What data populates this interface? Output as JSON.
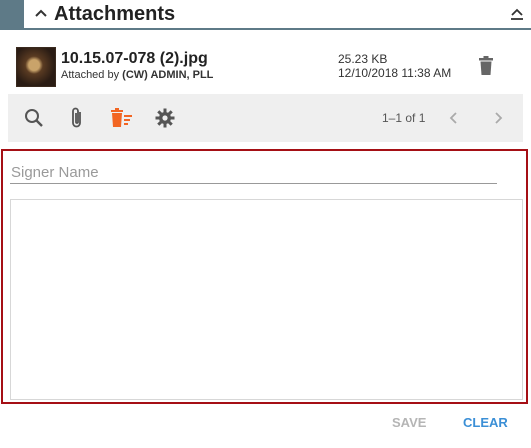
{
  "panel": {
    "title": "Attachments"
  },
  "attachment": {
    "file_name": "10.15.07-078 (2).jpg",
    "attached_prefix": "Attached by",
    "attached_by": "(CW) ADMIN, PLL",
    "size": "25.23 KB",
    "date": "12/10/2018 11:38 AM",
    "thumbnail_icon": "image-thumbnail",
    "delete_icon": "trash-icon"
  },
  "toolbar": {
    "icons": [
      "search-icon",
      "paperclip-icon",
      "delete-list-icon",
      "gear-icon"
    ],
    "accent_color": "#f26522",
    "pager_text": "1–1 of 1"
  },
  "signature": {
    "signer_placeholder": "Signer Name",
    "signer_value": "",
    "frame_color": "#a50f15"
  },
  "actions": {
    "save_label": "SAVE",
    "clear_label": "CLEAR"
  },
  "colors": {
    "header_accent": "#5e7a87",
    "link_blue": "#3b8fd6",
    "disabled_gray": "#b5b5b5"
  }
}
